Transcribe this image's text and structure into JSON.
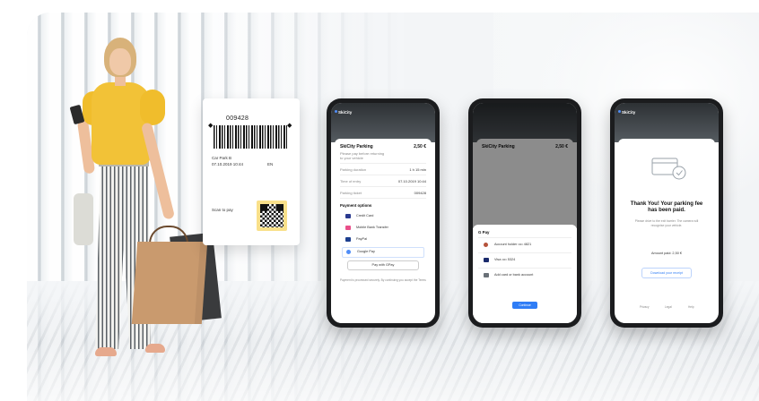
{
  "ticket": {
    "number": "009428",
    "line1": "Car Park B",
    "line2": "07.10.2019 10:44",
    "code": "EN",
    "scan_text": "Scan to pay"
  },
  "phone1": {
    "brand": "SkiCity",
    "title": "SkiCity Parking",
    "amount": "2,50 €",
    "subtitle1": "Please pay before returning",
    "subtitle2": "to your vehicle",
    "rows": [
      {
        "label": "Parking duration",
        "value": "1 h 15 min"
      },
      {
        "label": "Time of entry",
        "value": "07.10.2019 10:44"
      },
      {
        "label": "Parking ticket",
        "value": "009428"
      }
    ],
    "section": "Payment options",
    "options": [
      "Credit Card",
      "Mobile Bank Transfer",
      "PayPal",
      "Google Pay"
    ],
    "cta": "Pay with GPay",
    "footer": "Payment is processed securely. By continuing you accept the Terms"
  },
  "phone2": {
    "title": "SkiCity Parking",
    "amount": "2,50 €",
    "sheet_title": "G Pay",
    "options": [
      "Account holder •••• 4821",
      "Visa •••• 5324",
      "Add card or bank account"
    ],
    "button": "Continue"
  },
  "phone3": {
    "brand": "SkiCity",
    "heading": "Thank You! Your parking fee has been paid.",
    "message": "Please drive to the exit barrier. The camera will recognise your vehicle.",
    "amount_line": "Amount paid: 2,50 €",
    "receipt": "Download your receipt",
    "footer": [
      "Privacy",
      "Legal",
      "Help"
    ]
  },
  "colors": {
    "accent": "#2f7df6",
    "shirt": "#f2c237",
    "qr_bg": "#f9e08a"
  }
}
